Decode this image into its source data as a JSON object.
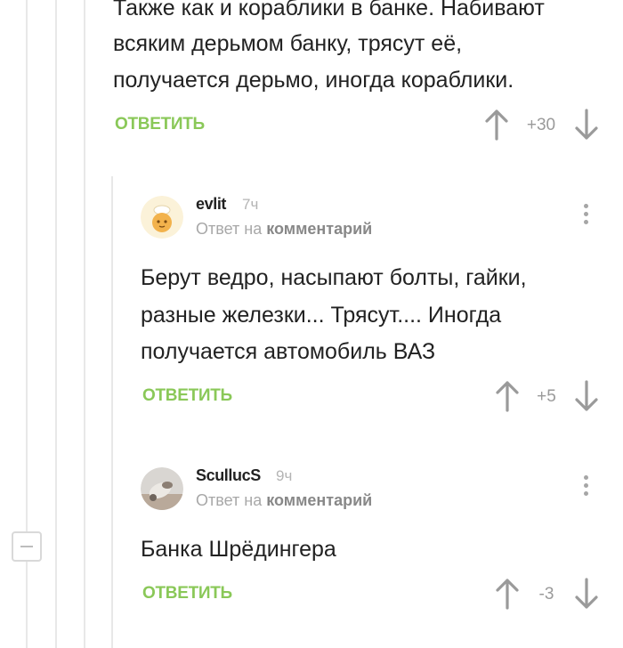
{
  "parent_comment": {
    "lines": [
      "Также как и кораблики в банке. Набивают",
      "всяким дерьмом банку, трясут её,",
      "получается дерьмо, иногда кораблики."
    ],
    "reply_label": "ОТВЕТИТЬ",
    "rating": "+30"
  },
  "comments": [
    {
      "username": "evlit",
      "time": "7ч",
      "meta_prefix": "Ответ на",
      "meta_link": "комментарий",
      "lines": [
        "Берут ведро, насыпают болты, гайки,",
        "разные железки... Трясут.... Иногда",
        "получается автомобиль ВАЗ"
      ],
      "reply_label": "ОТВЕТИТЬ",
      "rating": "+5"
    },
    {
      "username": "ScullucS",
      "time": "9ч",
      "meta_prefix": "Ответ на",
      "meta_link": "комментарий",
      "lines": [
        "Банка Шрёдингера"
      ],
      "reply_label": "ОТВЕТИТЬ",
      "rating": "-3"
    }
  ],
  "icons": {
    "vote_up": "arrow-up-icon",
    "vote_down": "arrow-down-icon",
    "more": "more-vertical-icon",
    "collapse": "minus-icon"
  },
  "colors": {
    "reply_green": "#8ac858",
    "text": "#222222",
    "muted": "#a8a8a8",
    "arrow": "#9a9a9a",
    "thread_line": "#e8e8e8"
  }
}
